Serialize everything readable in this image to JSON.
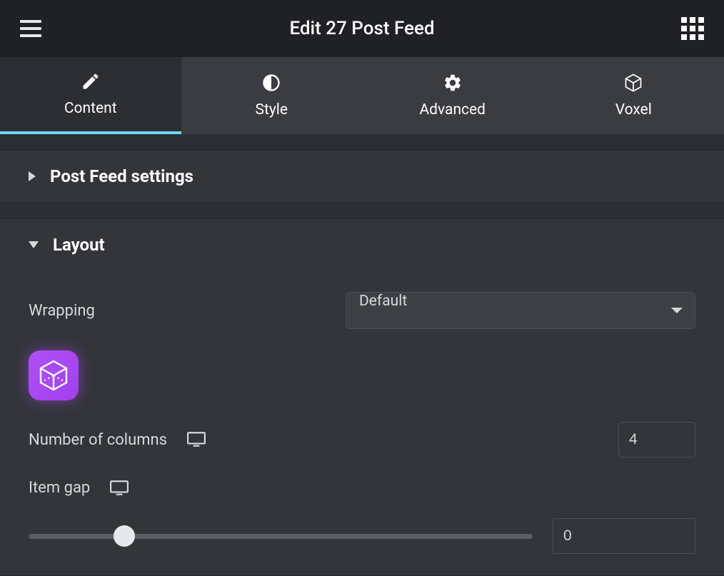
{
  "header": {
    "title": "Edit 27 Post Feed"
  },
  "tabs": [
    {
      "label": "Content",
      "active": true
    },
    {
      "label": "Style",
      "active": false
    },
    {
      "label": "Advanced",
      "active": false
    },
    {
      "label": "Voxel",
      "active": false
    }
  ],
  "sections": {
    "postFeed": {
      "title": "Post Feed settings",
      "expanded": false
    },
    "layout": {
      "title": "Layout",
      "expanded": true,
      "controls": {
        "wrapping": {
          "label": "Wrapping",
          "value": "Default"
        },
        "columns": {
          "label": "Number of columns",
          "value": "4"
        },
        "itemGap": {
          "label": "Item gap",
          "value": "0"
        }
      }
    }
  }
}
